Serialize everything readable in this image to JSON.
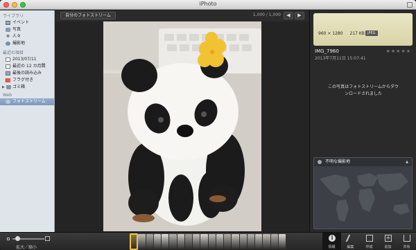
{
  "window": {
    "title": "iPhoto"
  },
  "sidebar": {
    "section_library": "ライブラリ",
    "library_items": [
      {
        "label": "イベント",
        "icon": "events-icon"
      },
      {
        "label": "写真",
        "icon": "photos-icon"
      },
      {
        "label": "人々",
        "icon": "faces-icon"
      },
      {
        "label": "撮影地",
        "icon": "places-icon"
      }
    ],
    "section_recent": "最近の項目",
    "recent_items": [
      {
        "label": "2013/07/11",
        "icon": "calendar-icon"
      },
      {
        "label": "最近の 12 カ月間",
        "icon": "calendar-icon"
      },
      {
        "label": "最後の読み込み",
        "icon": "import-icon"
      },
      {
        "label": "フラグ付き",
        "icon": "flag-icon"
      },
      {
        "label": "ゴミ箱",
        "icon": "trash-icon"
      }
    ],
    "section_web": "Web",
    "web_items": [
      {
        "label": "フォトストリーム",
        "icon": "photostream-icon",
        "selected": true
      }
    ]
  },
  "viewer": {
    "stream_button": "自分のフォトストリーム",
    "counter": "1,000 / 1,000",
    "prev": "◀",
    "next": "▶"
  },
  "info": {
    "dimensions": "960 × 1280",
    "size": "217 KB",
    "format": "JPEG",
    "rating": "★★★★★",
    "name": "IMG_7960",
    "date": "2013年7月11日 15:07:41",
    "stream_note_line1": "この写真はフォトストリームからダウ",
    "stream_note_line2": "ンロードされました",
    "location_title": "不明な撮影地",
    "location_toggle": "▲"
  },
  "bottom": {
    "zoom_label": "拡大／縮小",
    "zoom_level": 0.1,
    "filmstrip_colors": [
      "#8a7a52",
      "#c8c2b8",
      "#b0aca4",
      "#d9d4cc",
      "#e6e3de",
      "#b9b4ac",
      "#d2cdc5",
      "#a9a39a",
      "#cbc6be",
      "#dedad3",
      "#c4bfb7",
      "#d6d1c9",
      "#b5afa7",
      "#cfcac2",
      "#c1bcb4",
      "#bdb8b0",
      "#d3cec6",
      "#c6c1b9",
      "#b8b3ab",
      "#e0dcd6"
    ],
    "filmstrip_selected_index": 0,
    "tools": [
      {
        "label": "情報",
        "icon": "info-icon",
        "glyph": "i",
        "active": true
      },
      {
        "label": "編集",
        "icon": "edit-icon",
        "glyph": "",
        "active": false
      },
      {
        "label": "作成",
        "icon": "create-icon",
        "glyph": "",
        "active": false
      },
      {
        "label": "追加",
        "icon": "add-icon",
        "glyph": "+",
        "active": false
      },
      {
        "label": "共有",
        "icon": "share-icon",
        "glyph": "",
        "active": false
      }
    ]
  }
}
